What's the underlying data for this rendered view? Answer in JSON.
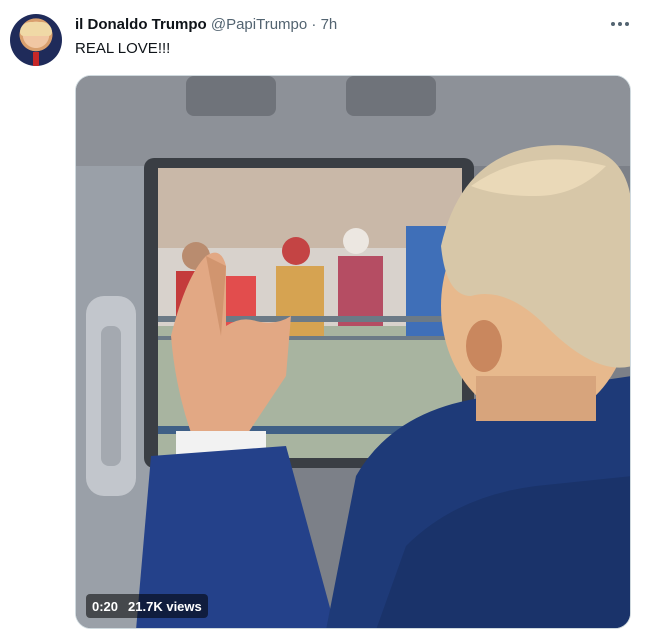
{
  "tweet": {
    "display_name": "il Donaldo Trumpo",
    "handle": "@PapiTrumpo",
    "separator": "·",
    "time": "7h",
    "text": "REAL LOVE!!!",
    "avatar_icon": "avatar-portrait",
    "more_icon": "more-dots-icon"
  },
  "video": {
    "duration": "0:20",
    "views": "21.7K views"
  }
}
